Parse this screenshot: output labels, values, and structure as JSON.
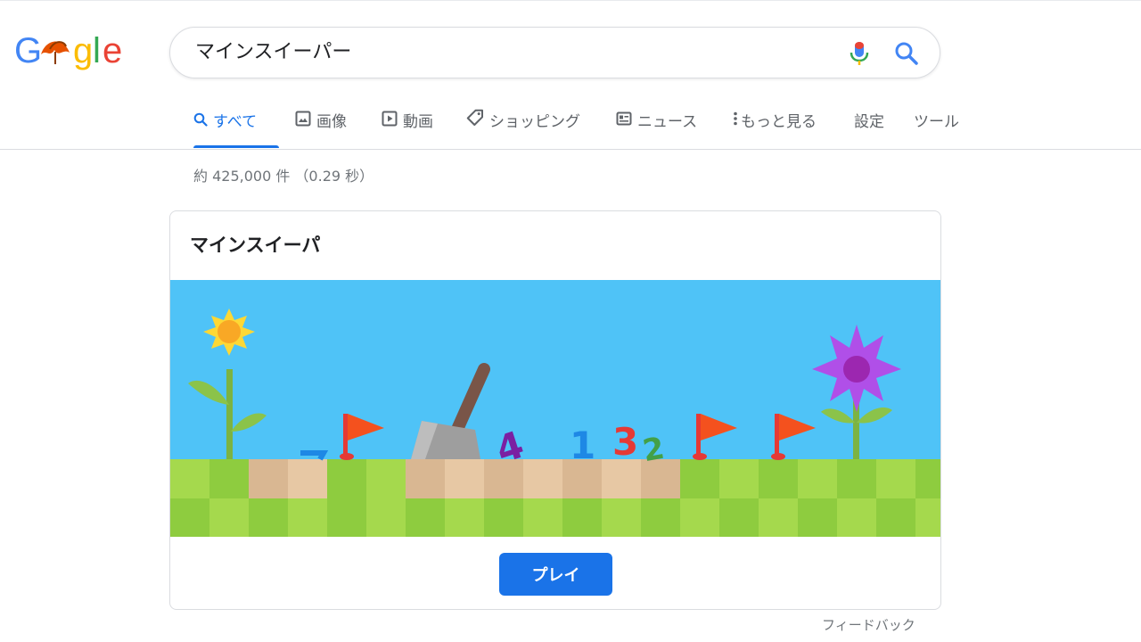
{
  "header": {
    "logo_text": "Google",
    "search": {
      "value": "マインスイーパー"
    }
  },
  "tabs": [
    {
      "label": "すべて",
      "icon": "search-icon",
      "active": true
    },
    {
      "label": "画像",
      "icon": "image-icon"
    },
    {
      "label": "動画",
      "icon": "video-icon"
    },
    {
      "label": "ショッピング",
      "icon": "tag-icon"
    },
    {
      "label": "ニュース",
      "icon": "news-icon"
    },
    {
      "label": "もっと見る",
      "icon": "more-vert-icon"
    },
    {
      "label": "設定"
    },
    {
      "label": "ツール"
    }
  ],
  "result_stats": "約 425,000 件 （0.29 秒）",
  "card": {
    "title": "マインスイーパ",
    "banner_numbers": [
      "4",
      "1",
      "3",
      "2"
    ],
    "play_label": "プレイ"
  },
  "feedback_label": "フィードバック",
  "colors": {
    "accent": "#1a73e8",
    "sky": "#4fc3f7",
    "grass_light": "#a5d94d",
    "grass_dark": "#8ecc3f",
    "dirt_light": "#e7c8a4",
    "dirt_dark": "#d9b792",
    "flag": "#f4511e",
    "sunflower": "#fdd835",
    "purple_flower": "#b04fe8"
  }
}
